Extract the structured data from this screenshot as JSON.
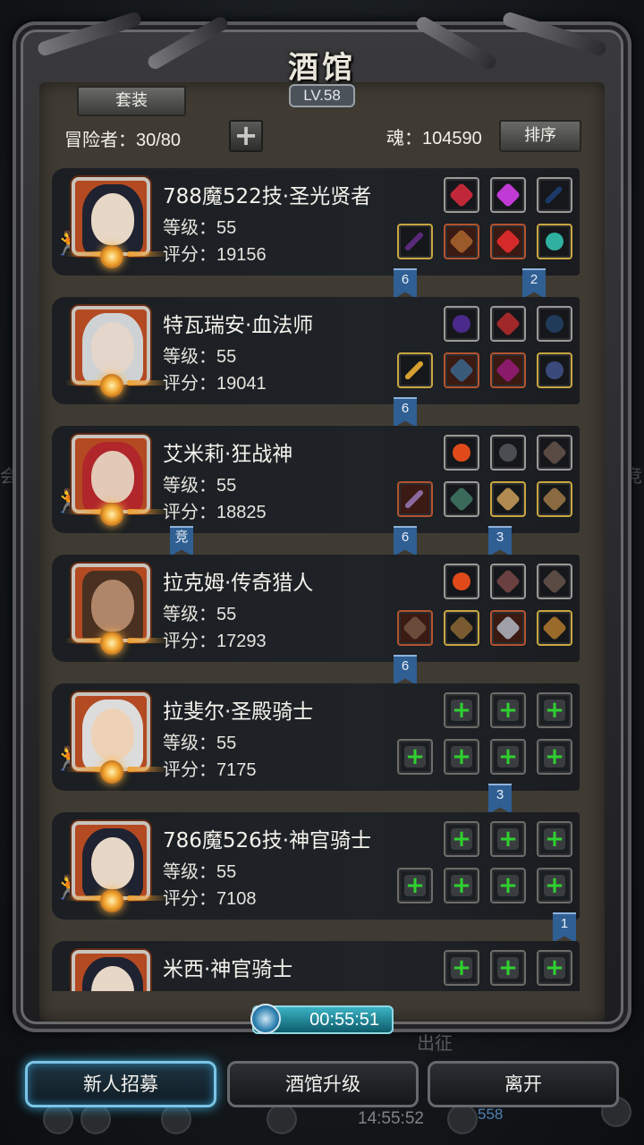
{
  "header": {
    "title": "酒馆",
    "level": "LV.58"
  },
  "toolbar": {
    "set_label": "套装",
    "adventurers": "冒险者：30/80",
    "add": "+",
    "soul": "魂：104590",
    "sort_label": "排序"
  },
  "heroes": [
    {
      "name": "788魔522技·圣光贤者",
      "level": "等级：55",
      "score": "评分：19156",
      "flags": [
        "6",
        "2"
      ]
    },
    {
      "name": "特瓦瑞安·血法师",
      "level": "等级：55",
      "score": "评分：19041",
      "flags": [
        "6"
      ]
    },
    {
      "name": "艾米莉·狂战神",
      "level": "等级：55",
      "score": "评分：18825",
      "flags": [
        "竞",
        "6",
        "3"
      ]
    },
    {
      "name": "拉克姆·传奇猎人",
      "level": "等级：55",
      "score": "评分：17293",
      "flags": [
        "6"
      ]
    },
    {
      "name": "拉斐尔·圣殿骑士",
      "level": "等级：55",
      "score": "评分：7175",
      "flags": [
        "3"
      ]
    },
    {
      "name": "786魔526技·神官骑士",
      "level": "等级：55",
      "score": "评分：7108",
      "flags": [
        "1"
      ]
    },
    {
      "name": "米西·神官骑士",
      "level": "",
      "score": "",
      "flags": []
    }
  ],
  "timer": "00:55:51",
  "footer": {
    "recruit": "新人招募",
    "upgrade": "酒馆升级",
    "leave": "离开"
  },
  "background": {
    "dispatch": "出征",
    "clock": "14:55:52",
    "count": "558",
    "left_text": "会",
    "right_text": "竞"
  },
  "colors": {
    "accent": "#3aa7d6",
    "flag_blue": "#2f5f93",
    "empty_slot_plus": "#2fd12f"
  }
}
